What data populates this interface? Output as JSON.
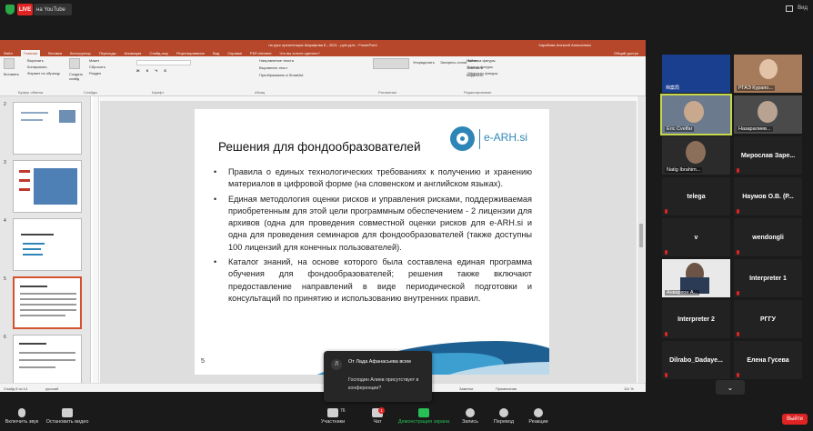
{
  "top": {
    "live": "LIVE",
    "youtube": "на YouTube",
    "view": "Вид"
  },
  "ppt": {
    "title": "на русс презентация Шарифова Б., 2021 - pptx.pptx - PowerPoint",
    "user": "Харибова Алексей Алексеевич",
    "menu": [
      "Файл",
      "Главная",
      "Вставка",
      "Конструктор",
      "Переходы",
      "Анимация",
      "Слайд-шоу",
      "Рецензирование",
      "Вид",
      "Справка",
      "PDF-element",
      "Что вы хотите сделать?"
    ],
    "share": "Общий доступ",
    "ribbon": {
      "groups": [
        "Буфер обмена",
        "Слайды",
        "Шрифт",
        "Абзац",
        "Рисование",
        "Редактирование"
      ],
      "items": [
        "Вставить",
        "Вырезать",
        "Копировать",
        "Формат по образцу",
        "Создать слайд",
        "Макет",
        "Сбросить",
        "Раздел",
        "Направление текста",
        "Выровнять текст",
        "Преобразовать в SmartArt",
        "Упорядочить",
        "Экспресс-стили",
        "Заливка фигуры",
        "Контур фигуры",
        "Эффекты фигуры",
        "Найти",
        "Заменить",
        "Выделить"
      ]
    },
    "status": {
      "slide": "Слайд 5 из 14",
      "lang": "русский",
      "notes": "Заметки",
      "comments": "Примечания",
      "zoom": "111 %"
    },
    "thumb_nums": [
      "2",
      "3",
      "4",
      "5",
      "6"
    ]
  },
  "slide": {
    "title": "Решения для фондообразователей",
    "logo": "e-ARH.si",
    "number": "5",
    "bullets": [
      "Правила о единых технологических требованиях к получению и хранению материалов в цифровой форме (на словенском и английском языках).",
      "Единая методология оценки рисков и управления рисками, поддерживаемая приобретенным для этой цели программным обеспечением - 2 лицензии для архивов (одна для проведения совместной оценки рисков для e-ARH.si и одна для проведения семинаров для фондообразователей (также доступны 100 лицензий для конечных пользователей).",
      "Каталог знаний, на основе которого была составлена единая программа обучения для фондообразователей; решения также включают предоставление направлений в виде периодической подготовки и консультаций по принятию и использованию внутренних правил."
    ]
  },
  "chat": {
    "avatar": "Л",
    "from": "От Лада Афанасьева всем",
    "message": "Господин Алиев присутствует в конференции?"
  },
  "gallery": {
    "tiles": [
      {
        "name": "",
        "kind": "video"
      },
      {
        "name": "РГАЭ Курапо...",
        "kind": "video"
      },
      {
        "name": "Eric Cvelfar",
        "kind": "video"
      },
      {
        "name": "Назаралиев...",
        "kind": "video"
      },
      {
        "name": "Natig Ibrahim...",
        "kind": "video"
      },
      {
        "name": "Мирослав Заре...",
        "kind": "text"
      },
      {
        "name": "telega",
        "kind": "text"
      },
      {
        "name": "Наумов О.В. (Р...",
        "kind": "text"
      },
      {
        "name": "v",
        "kind": "text"
      },
      {
        "name": "wendongli",
        "kind": "text"
      },
      {
        "name": "Анвархон А...",
        "kind": "video"
      },
      {
        "name": "Interpreter 1",
        "kind": "text"
      },
      {
        "name": "Interpreter 2",
        "kind": "text"
      },
      {
        "name": "РГГУ",
        "kind": "text"
      },
      {
        "name": "Dilrabo_Dadaye...",
        "kind": "text"
      },
      {
        "name": "Елена Гусева",
        "kind": "text"
      }
    ],
    "video_tile_1_label": "档案局"
  },
  "toolbar": {
    "mute": "Включить звук",
    "video": "Остановить видео",
    "participants": "Участники",
    "participants_count": "76",
    "chat": "Чат",
    "chat_badge": "1",
    "share": "Демонстрация экрана",
    "record": "Запись",
    "translate": "Перевод",
    "reactions": "Реакции",
    "leave": "Выйти"
  }
}
